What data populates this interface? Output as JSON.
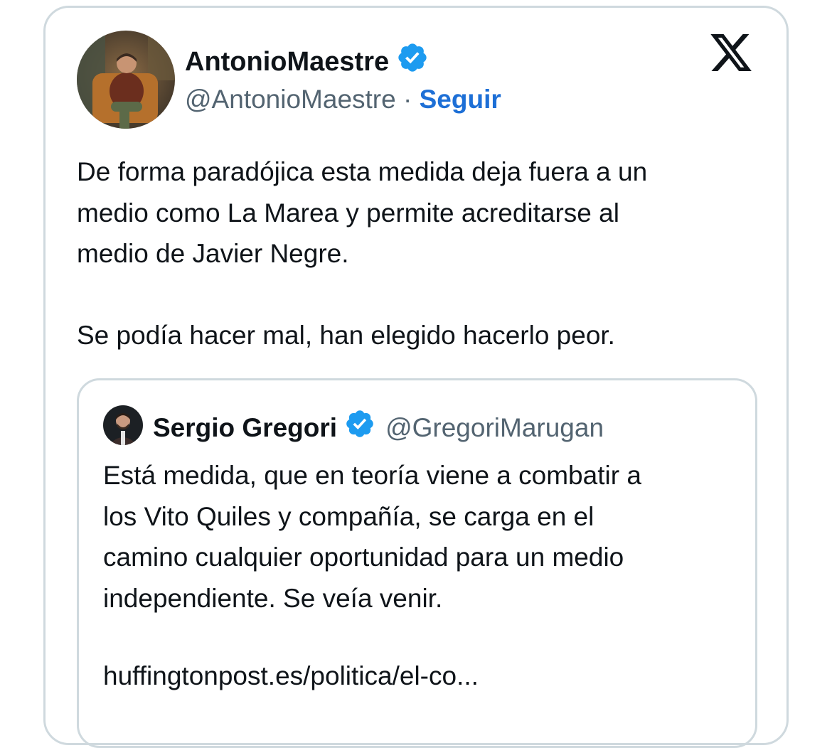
{
  "tweet": {
    "author": {
      "name": "AntonioMaestre",
      "handle": "@AntonioMaestre",
      "verified_icon": "verified-badge-icon"
    },
    "separator": "·",
    "follow_label": "Seguir",
    "brand_icon": "x-logo-icon",
    "text": "De forma paradójica esta medida deja fuera a un\nmedio como La Marea y permite acreditarse al\nmedio de Javier Negre.\n\nSe podía hacer mal, han elegido hacerlo peor."
  },
  "quoted_tweet": {
    "author": {
      "name": "Sergio Gregori",
      "handle": "@GregoriMarugan",
      "verified_icon": "verified-badge-icon"
    },
    "text": "Está medida, que en teoría viene a combatir a\nlos Vito Quiles y compañía, se carga en el\ncamino cualquier oportunidad para un medio\nindependiente. Se veía venir.",
    "link": "huffingtonpost.es/politica/el-co..."
  },
  "colors": {
    "accent": "#1d9bf0",
    "follow": "#1d6fd6",
    "text_primary": "#0f1419",
    "text_secondary": "#536471",
    "border": "#cfd9de"
  }
}
